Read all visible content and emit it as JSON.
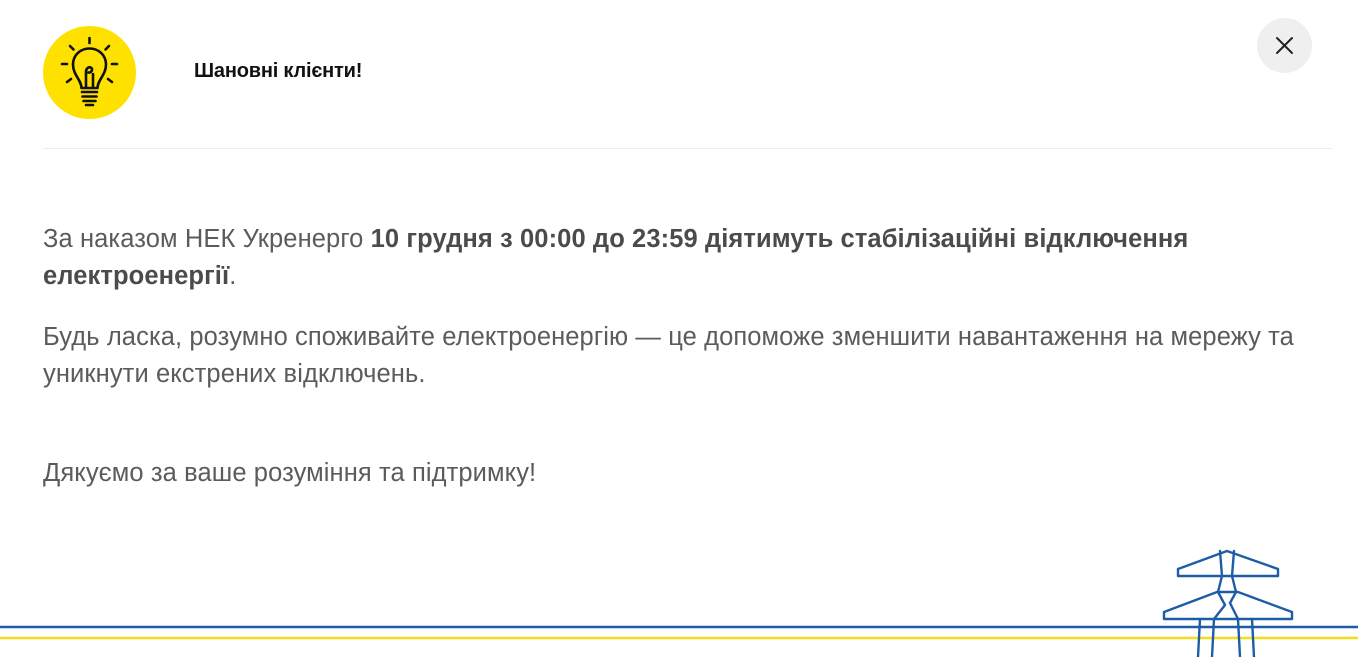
{
  "modal": {
    "title": "Шановні клієнти!",
    "close_label": "×",
    "icon": "lightbulb-icon",
    "colors": {
      "accent_yellow": "#ffe100",
      "accent_blue": "#1e5ca8",
      "text": "#5b5b5b"
    }
  },
  "content": {
    "p1_pre": "За наказом НЕК Укренерго ",
    "p1_bold": "10 грудня з 00:00 до 23:59 діятимуть стабілізаційні відключення електроенергії",
    "p1_post": ".",
    "p2": "Будь ласка, розумно споживайте електроенергію — це допоможе зменшити навантаження на мережу та уникнути екстрених відключень.",
    "p3": "Дякуємо за ваше розуміння та підтримку!"
  },
  "decor": {
    "pylon": "power-line-pylon-icon"
  }
}
